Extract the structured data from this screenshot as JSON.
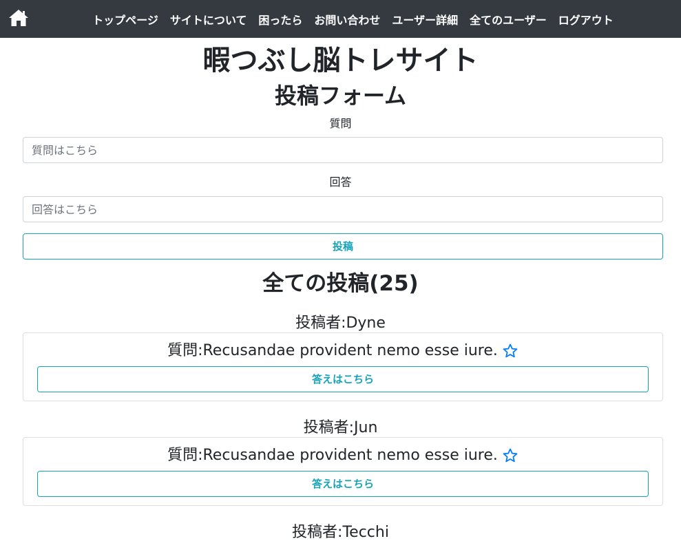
{
  "nav": {
    "items": [
      "トップページ",
      "サイトについて",
      "困ったら",
      "お問い合わせ",
      "ユーザー詳細",
      "全てのユーザー",
      "ログアウト"
    ]
  },
  "site_title": "暇つぶし脳トレサイト",
  "form": {
    "title": "投稿フォーム",
    "question_label": "質問",
    "question_placeholder": "質問はこちら",
    "question_value": "",
    "answer_label": "回答",
    "answer_placeholder": "回答はこちら",
    "answer_value": "",
    "submit_label": "投稿"
  },
  "posts": {
    "heading": "全ての投稿(25)",
    "items": [
      {
        "author": "投稿者:Dyne",
        "question": "質問:Recusandae provident nemo esse iure.",
        "answer_button": "答えはこちら"
      },
      {
        "author": "投稿者:Jun",
        "question": "質問:Recusandae provident nemo esse iure.",
        "answer_button": "答えはこちら"
      },
      {
        "author": "投稿者:Tecchi"
      }
    ]
  },
  "icons": {
    "home": "home-icon",
    "favorite": "star-outline-icon"
  },
  "colors": {
    "navbar": "#343a40",
    "accent": "#17a2b8",
    "star": "#007bff"
  }
}
